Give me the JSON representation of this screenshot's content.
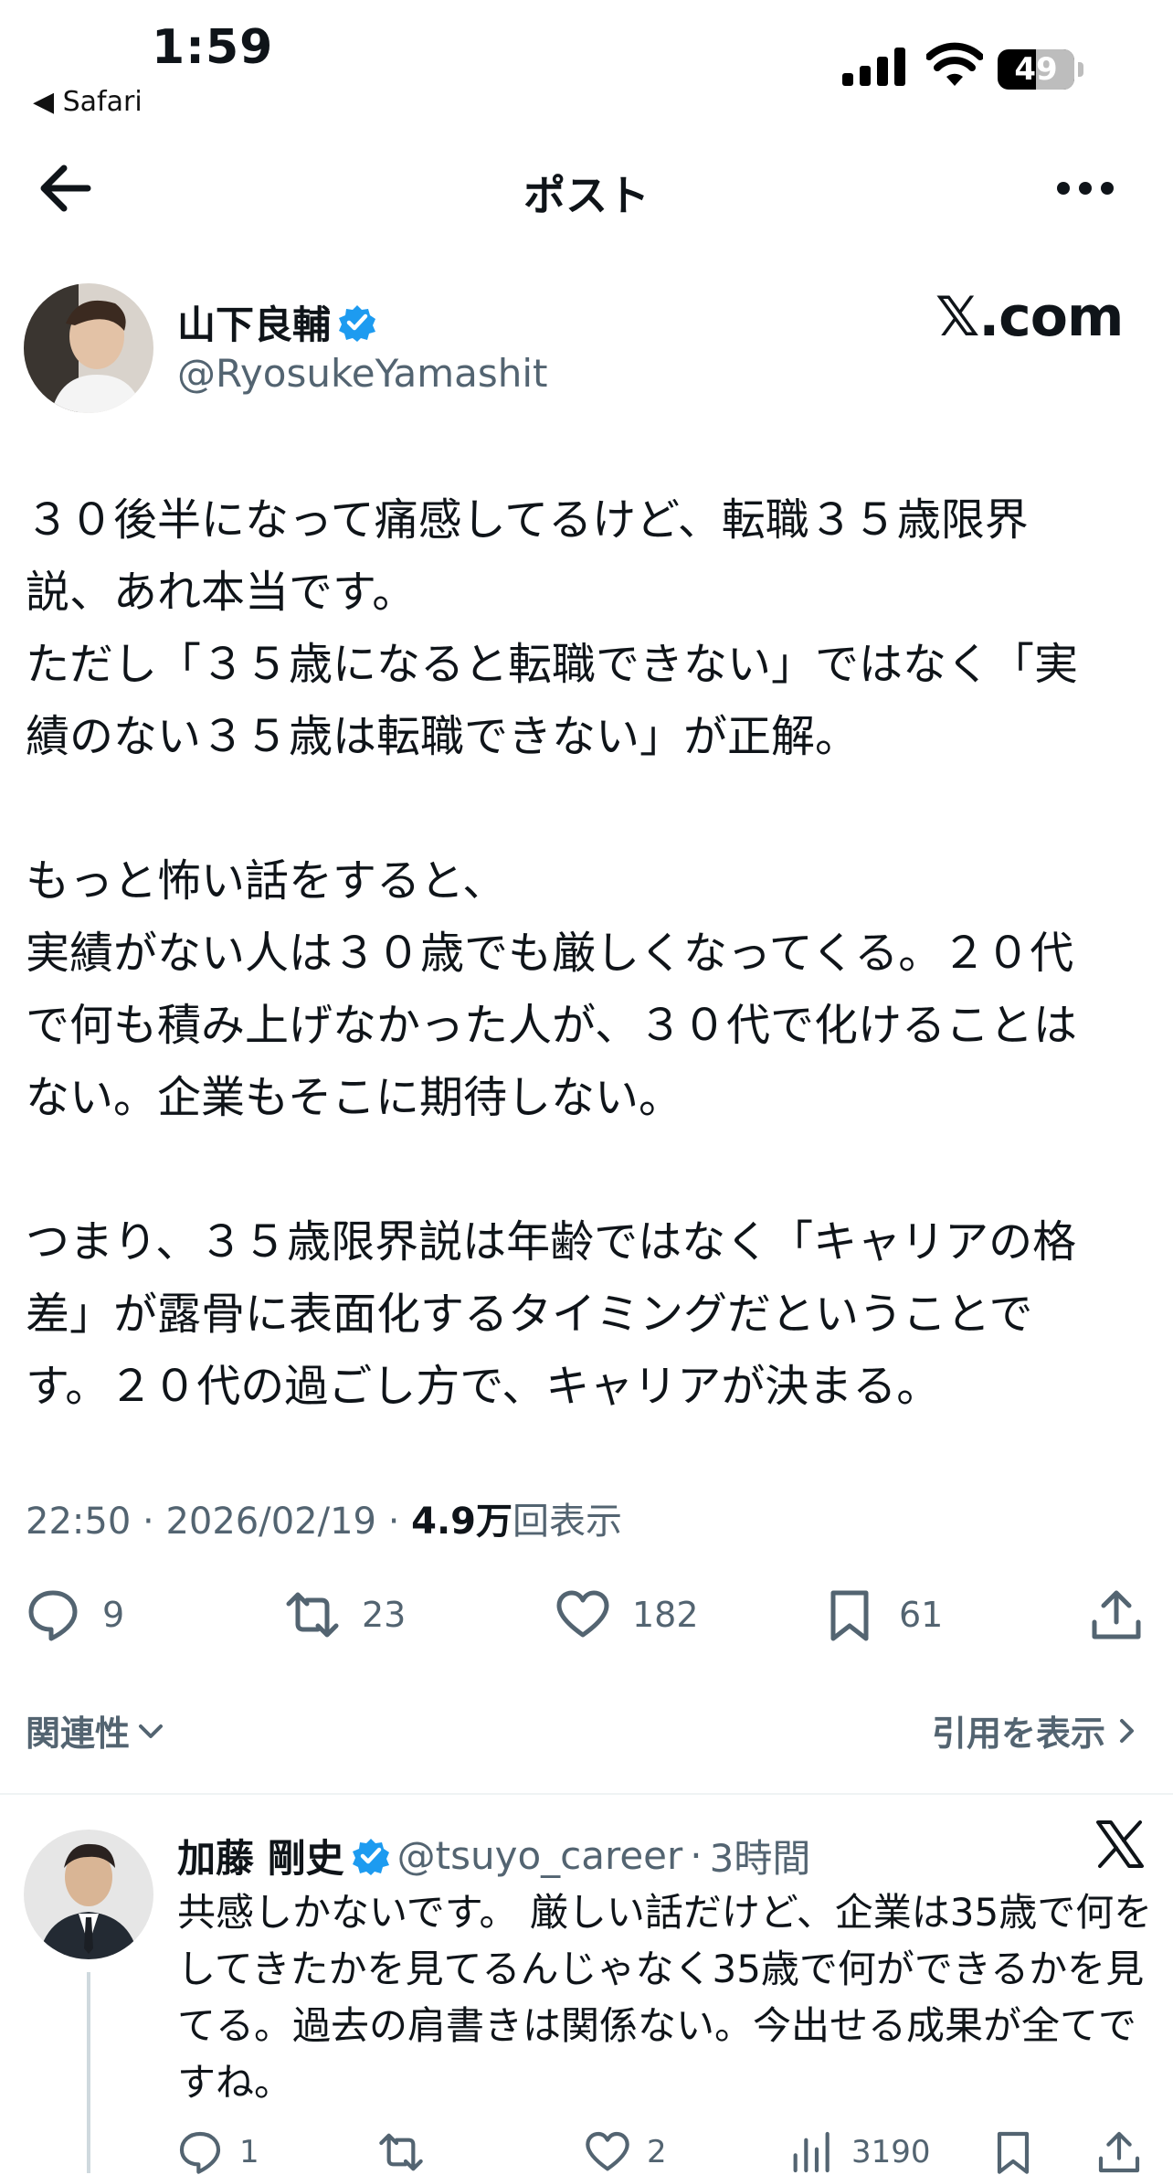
{
  "status_bar": {
    "time": "1:59",
    "back_app": "◀ Safari",
    "battery": "49"
  },
  "nav": {
    "title": "ポスト"
  },
  "post": {
    "author_name": "山下良輔",
    "author_handle": "@RyosukeYamashit",
    "source": "𝕏.com",
    "text": "３０後半になって痛感してるけど、転職３５歳限界\n説、あれ本当です。\nただし「３５歳になると転職できない」ではなく「実\n績のない３５歳は転職できない」が正解。\n\nもっと怖い話をすると、\n実績がない人は３０歳でも厳しくなってくる。２０代\nで何も積み上げなかった人が、３０代で化けることは\nない。企業もそこに期待しない。\n\nつまり、３５歳限界説は年齢ではなく「キャリアの格\n差」が露骨に表面化するタイミングだということで\nす。２０代の過ごし方で、キャリアが決まる。",
    "time": "22:50",
    "date": "2026/02/19",
    "views": "4.9万",
    "views_label": "回表示",
    "replies": "9",
    "reposts": "23",
    "likes": "182",
    "bookmarks": "61",
    "relevance_label": "関連性",
    "quotes_label": "引用を表示"
  },
  "reply": {
    "author_name": "加藤 剛史",
    "author_handle": "@tsuyo_career",
    "time_ago": "3時間",
    "text": "共感しかないです。 厳しい話だけど、企業は35歳で何をしてきたかを見てるんじゃなく35歳で何ができるかを見てる。過去の肩書きは関係ない。今出せる成果が全てですね。",
    "replies": "1",
    "likes": "2",
    "views": "3190"
  },
  "colors": {
    "text": "#0f1419",
    "secondary": "#536471",
    "verified": "#1d9bf0"
  }
}
